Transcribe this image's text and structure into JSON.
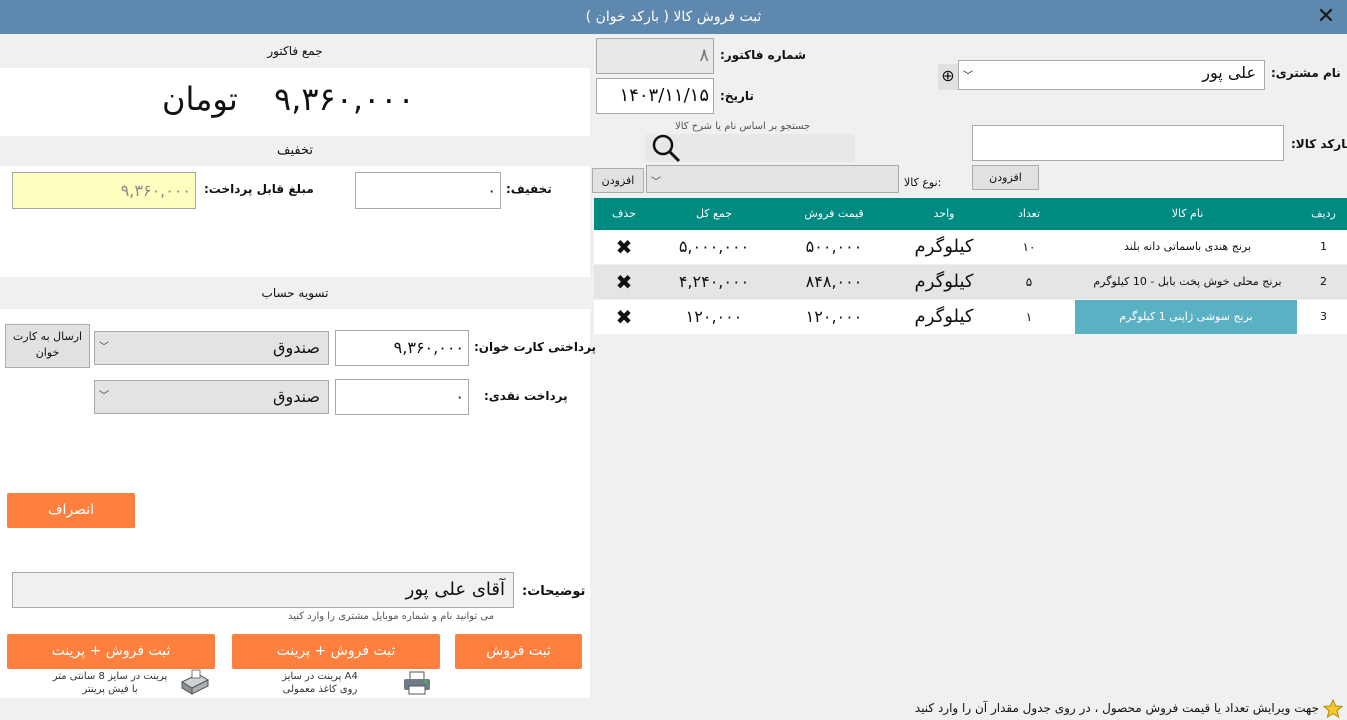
{
  "window": {
    "title": "ثبت فروش کالا ( بارکد خوان )",
    "close_glyph": "✕"
  },
  "invoice": {
    "total_header": "جمع فاکتور",
    "total_amount": "۹,۳۶۰,۰۰۰",
    "currency": "تومان"
  },
  "discount": {
    "header": "تخفیف",
    "discount_label": "تخفیف:",
    "discount_value": "۰",
    "payable_label": "مبلغ قابل پرداخت:",
    "payable_value": "۹,۳۶۰,۰۰۰"
  },
  "settlement": {
    "header": "تسویه حساب",
    "card_label": "پرداختی کارت خوان:",
    "card_value": "۹,۳۶۰,۰۰۰",
    "card_account": "صندوق",
    "send_to_card_reader": "ارسال به کارت خوان",
    "cash_label": "پرداخت نقدی:",
    "cash_value": "۰",
    "cash_account": "صندوق"
  },
  "cancel_button": "انصراف",
  "notes": {
    "label": "توضیحات:",
    "value": "آقای علی پور",
    "hint": "می توانید نام و شماره موبایل مشتری را وارد کنید"
  },
  "actions": {
    "save": "ثبت فروش",
    "save_print_a4": "ثبت فروش + پرینت",
    "save_print_a4_caption_1": "پرینت در سایز A4",
    "save_print_a4_caption_2": "روی کاغذ معمولی",
    "save_print_8cm": "ثبت فروش + پرینت",
    "save_print_8cm_caption_1": "پرینت در سایز 8 سانتی متر",
    "save_print_8cm_caption_2": "با فیش پرینتر"
  },
  "header_form": {
    "customer_label": "نام مشتری:",
    "customer_value": "علی پور",
    "invoice_no_label": "شماره فاکتور:",
    "invoice_no_value": "۸",
    "date_label": "تاریخ:",
    "date_value": "۱۴۰۳/۱۱/۱۵"
  },
  "barcode": {
    "label": "بارکد کالا:",
    "add_button": "افزودن"
  },
  "search": {
    "hint": "جستجو بر اساس نام یا شرح کالا",
    "type_label": "نوع کالا:",
    "add_button": "افزودن"
  },
  "table": {
    "columns": [
      "ردیف",
      "نام کالا",
      "تعداد",
      "واحد",
      "قیمت فروش",
      "جمع کل",
      "حذف"
    ],
    "rows": [
      {
        "idx": "1",
        "name": "برنج هندی باسماتی دانه بلند",
        "qty": "۱۰",
        "unit": "کیلوگرم",
        "price": "۵۰۰,۰۰۰",
        "total": "۵,۰۰۰,۰۰۰"
      },
      {
        "idx": "2",
        "name": "برنج محلی خوش پخت بابل - 10 کیلوگرم",
        "qty": "۵",
        "unit": "کیلوگرم",
        "price": "۸۴۸,۰۰۰",
        "total": "۴,۲۴۰,۰۰۰"
      },
      {
        "idx": "3",
        "name": "برنج سوشی ژاپنی 1 کیلوگرم",
        "qty": "۱",
        "unit": "کیلوگرم",
        "price": "۱۲۰,۰۰۰",
        "total": "۱۲۰,۰۰۰"
      }
    ],
    "delete_glyph": "✖"
  },
  "status": {
    "text": "جهت ویرایش تعداد یا قیمت فروش محصول ، در روی جدول مقدار آن را وارد کنید"
  },
  "colors": {
    "titlebar": "#5f88ae",
    "table_header": "#008b82",
    "button_orange": "#ff7f3f",
    "payable_bg": "#ffffc0",
    "selected_cell": "#5ab1c4"
  }
}
